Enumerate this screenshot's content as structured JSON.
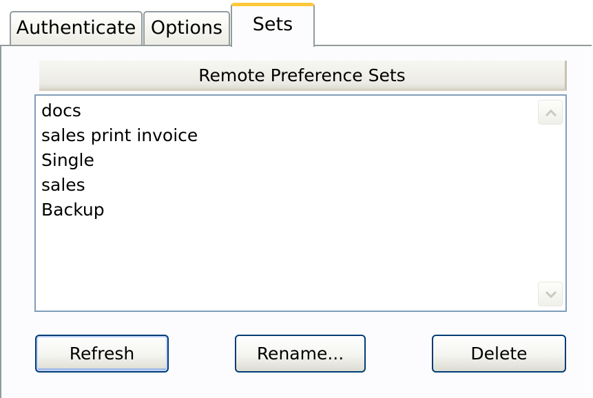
{
  "tabs": [
    {
      "label": "Authenticate",
      "selected": false
    },
    {
      "label": "Options",
      "selected": false
    },
    {
      "label": "Sets",
      "selected": true
    }
  ],
  "list": {
    "header": "Remote Preference Sets",
    "items": [
      "docs",
      "sales print invoice",
      "Single",
      "sales",
      "Backup"
    ]
  },
  "scrollbar": {
    "up_icon": "chevron-up-icon",
    "down_icon": "chevron-down-icon"
  },
  "buttons": {
    "refresh": "Refresh",
    "rename": "Rename...",
    "delete": "Delete"
  },
  "colors": {
    "selected_tab_accent": "#ffc83c",
    "default_button_border": "#003c74",
    "list_border": "#7f9db9",
    "panel_background": "#fcfcfe"
  }
}
